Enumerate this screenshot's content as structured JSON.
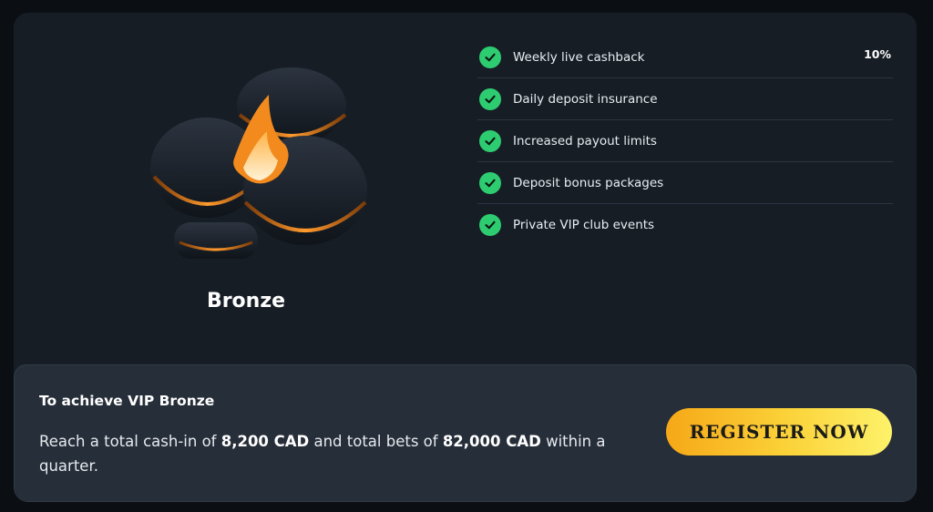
{
  "tier": {
    "name": "Bronze"
  },
  "benefits": [
    {
      "label": "Weekly live cashback",
      "value": "10%",
      "icon": "check-circle-icon"
    },
    {
      "label": "Daily deposit insurance",
      "value": "",
      "icon": "check-circle-icon"
    },
    {
      "label": "Increased payout limits",
      "value": "",
      "icon": "check-circle-icon"
    },
    {
      "label": "Deposit bonus packages",
      "value": "",
      "icon": "check-circle-icon"
    },
    {
      "label": "Private VIP club events",
      "value": "",
      "icon": "check-circle-icon"
    }
  ],
  "requirement": {
    "title": "To achieve VIP Bronze",
    "text_before": "Reach a total cash-in of ",
    "cash_in_amount": "8,200 CAD",
    "text_middle": " and total bets of ",
    "bets_amount": "82,000 CAD",
    "text_after": " within a quarter."
  },
  "cta": {
    "label": "REGISTER NOW"
  },
  "colors": {
    "check": "#2ecc71",
    "accent_orange": "#f28a1e",
    "button_gradient_start": "#f6a817",
    "button_gradient_end": "#fdf26a"
  }
}
